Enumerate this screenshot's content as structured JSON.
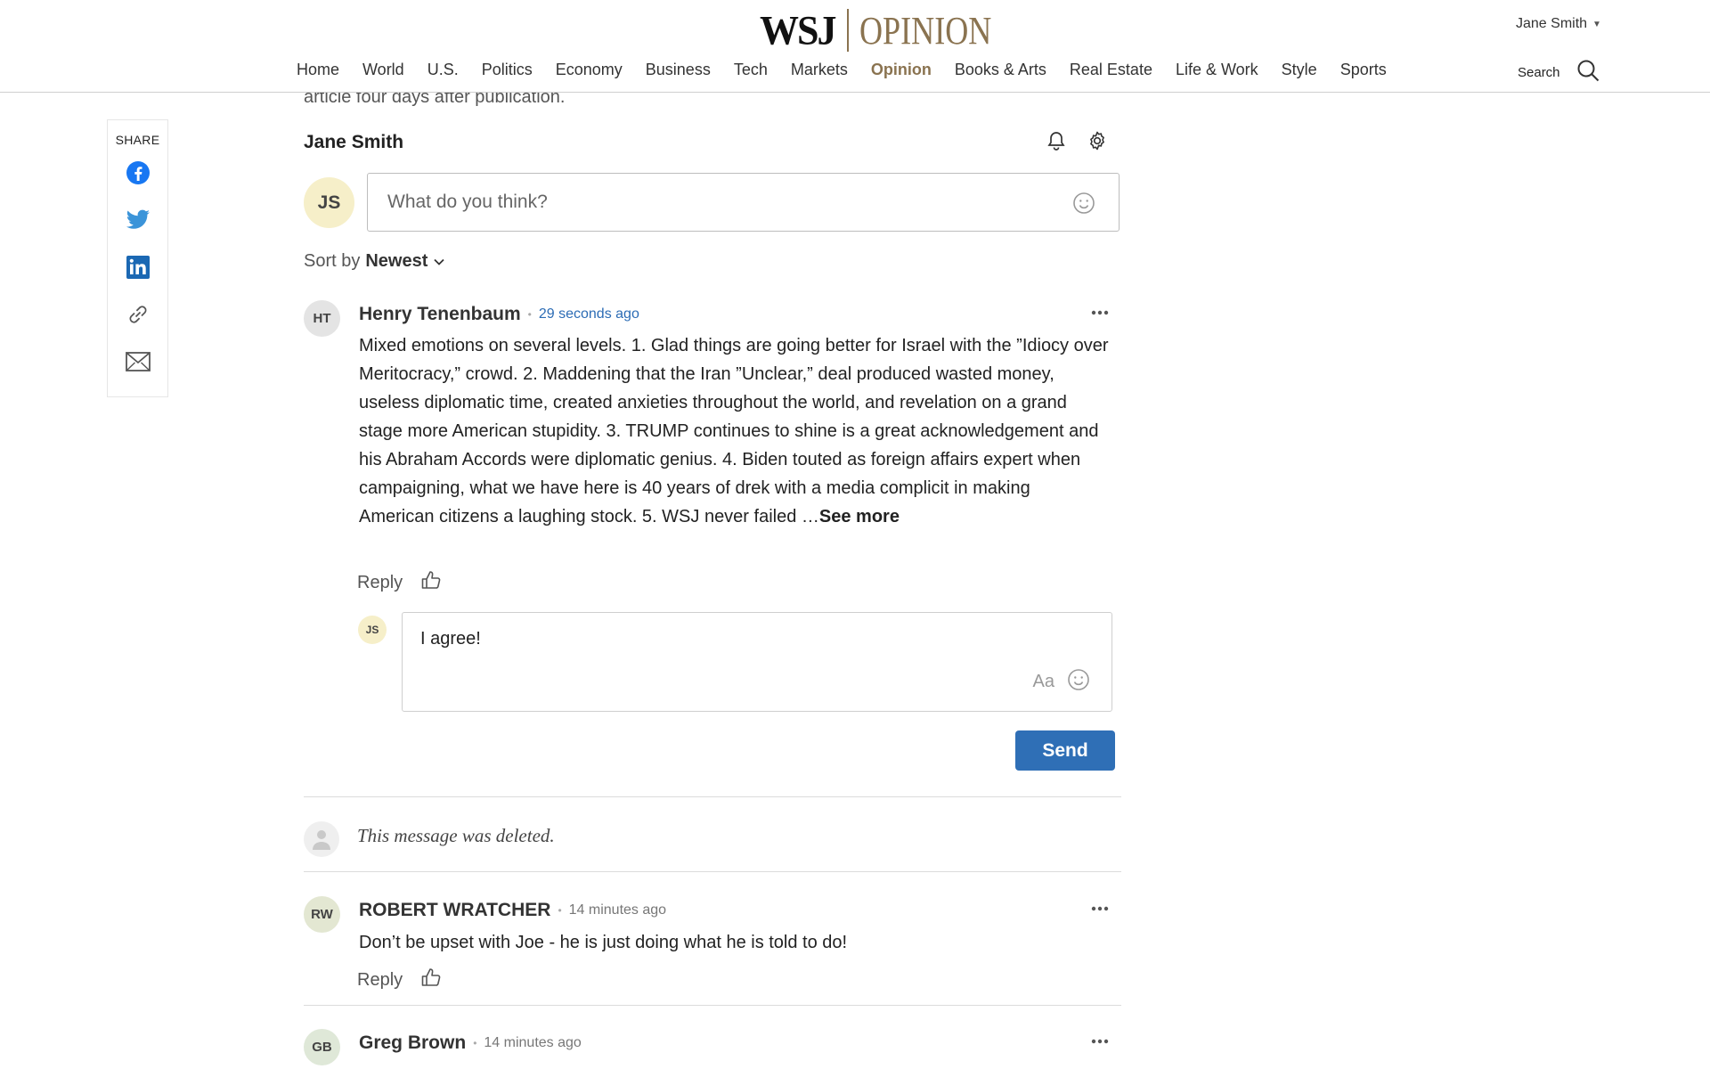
{
  "header": {
    "logo_wsj": "WSJ",
    "logo_section": "OPINION",
    "user_name": "Jane Smith",
    "search_label": "Search",
    "nav": [
      {
        "label": "Home"
      },
      {
        "label": "World"
      },
      {
        "label": "U.S."
      },
      {
        "label": "Politics"
      },
      {
        "label": "Economy"
      },
      {
        "label": "Business"
      },
      {
        "label": "Tech"
      },
      {
        "label": "Markets"
      },
      {
        "label": "Opinion",
        "active": true
      },
      {
        "label": "Books & Arts"
      },
      {
        "label": "Real Estate"
      },
      {
        "label": "Life & Work"
      },
      {
        "label": "Style"
      },
      {
        "label": "Sports"
      }
    ],
    "active_color": "#8a7350"
  },
  "share": {
    "label": "SHARE",
    "buttons": [
      "facebook-icon",
      "twitter-icon",
      "linkedin-icon",
      "link-icon",
      "email-icon"
    ]
  },
  "article": {
    "tail_text": "article four days after publication."
  },
  "comments": {
    "viewer_name": "Jane Smith",
    "viewer_initials": "JS",
    "input_placeholder": "What do you think?",
    "sort_prefix": "Sort by",
    "sort_value": "Newest",
    "reply_label": "Reply",
    "see_more_label": "See more",
    "reply_draft": "I agree!",
    "aa_label": "Aa",
    "send_label": "Send",
    "deleted_text": "This message was deleted.",
    "items": [
      {
        "initials": "HT",
        "name": "Henry Tenenbaum",
        "time": "29 seconds ago",
        "text": "Mixed emotions on several levels. 1. Glad things are going better for Israel with the ”Idiocy over Meritocracy,” crowd. 2. Maddening that the Iran ”Unclear,” deal produced wasted money, useless diplomatic time, created anxieties throughout the world,  and revelation on a grand stage more American stupidity. 3. TRUMP continues to shine is a great acknowledgement and his Abraham Accords were diplomatic genius. 4. Biden touted as foreign affairs expert when campaigning, what we have here is 40 years of drek with a media complicit in making American citizens a laughing stock. 5. WSJ never failed …"
      },
      {
        "initials": "RW",
        "name": "ROBERT WRATCHER",
        "time": "14 minutes ago",
        "text": "Don’t be upset with Joe - he is just doing what he is told to do!"
      },
      {
        "initials": "GB",
        "name": "Greg Brown",
        "time": "14 minutes ago"
      }
    ]
  },
  "colors": {
    "send_button": "#2f6fb6",
    "recent_time": "#2c6cb5",
    "viewer_avatar": "#f6efc9"
  }
}
